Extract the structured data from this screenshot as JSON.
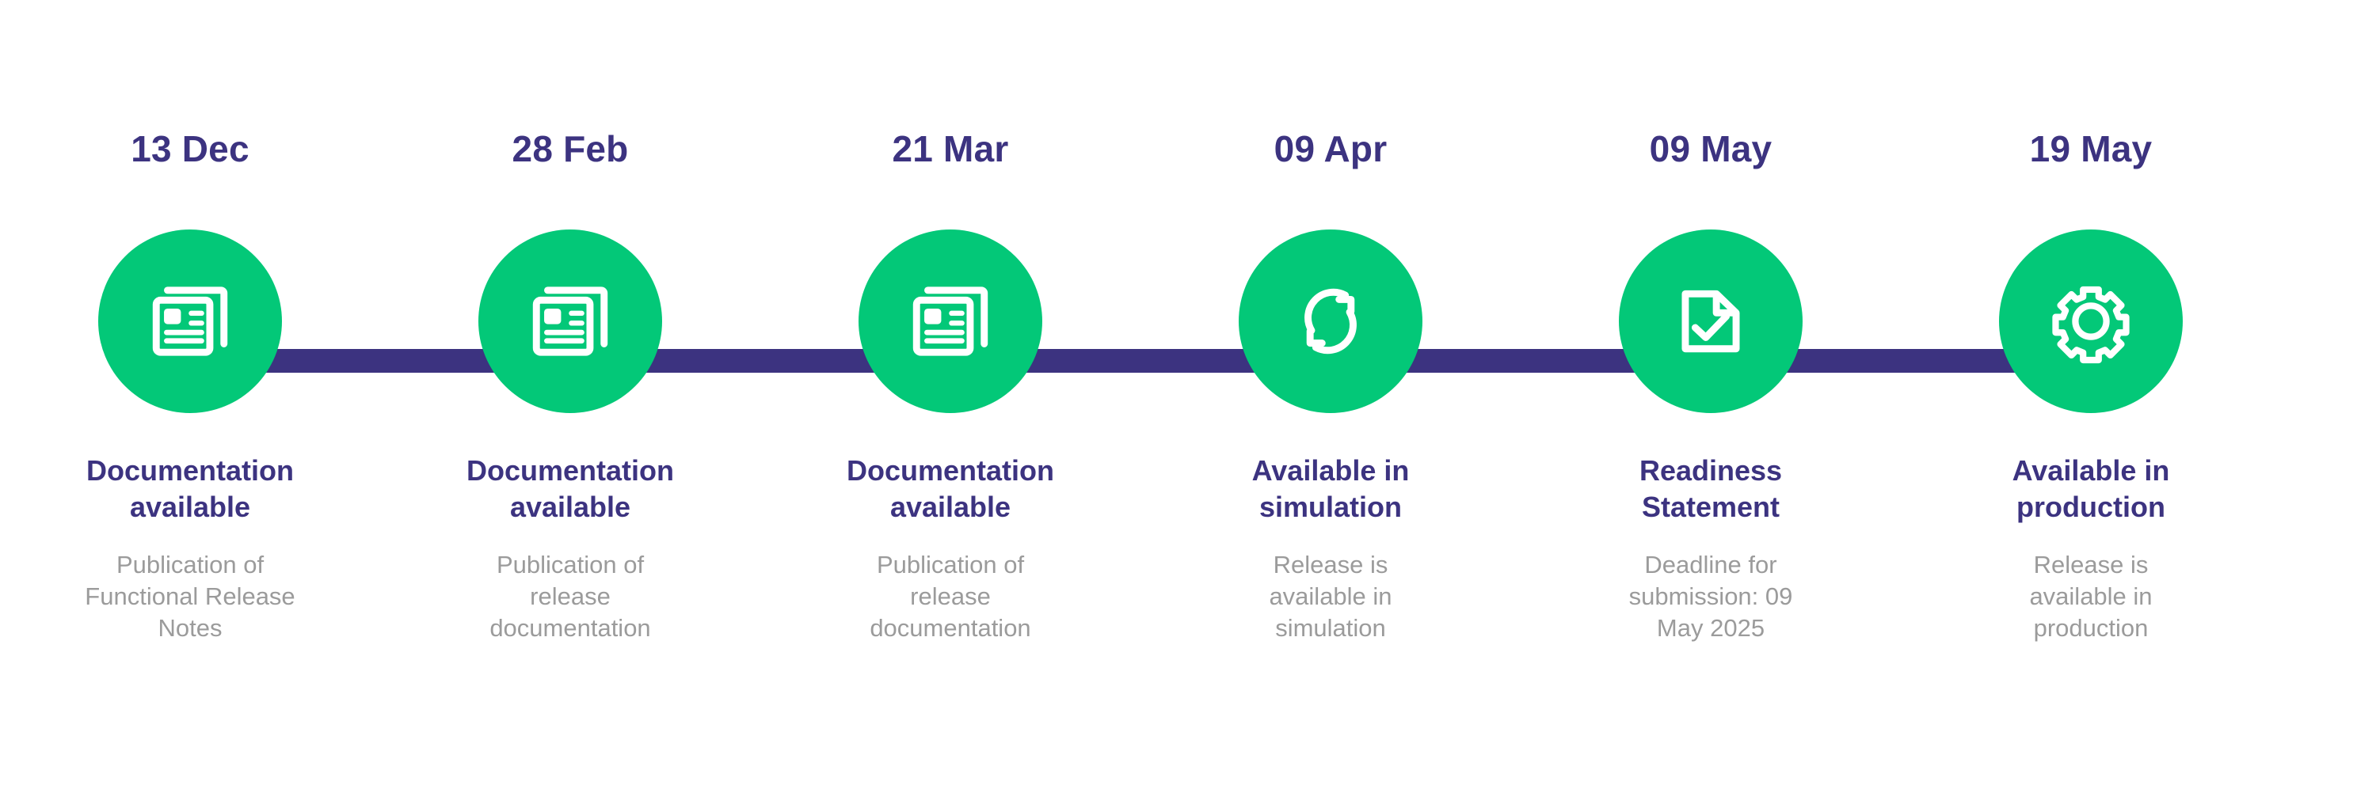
{
  "theme": {
    "accent_green": "#03C878",
    "accent_purple": "#3C3380",
    "description_gray": "#9B9B9B",
    "background": "#FFFFFF"
  },
  "timeline": {
    "name": "release-timeline",
    "orientation": "horizontal",
    "steps": [
      {
        "date": "13 Dec",
        "icon": "newspaper-icon",
        "title_line1": "Documentation",
        "title_line2": "available",
        "desc_line1": "Publication of",
        "desc_line2": "Functional Release",
        "desc_line3": "Notes"
      },
      {
        "date": "28 Feb",
        "icon": "newspaper-icon",
        "title_line1": "Documentation",
        "title_line2": "available",
        "desc_line1": "Publication of",
        "desc_line2": "release",
        "desc_line3": "documentation"
      },
      {
        "date": "21 Mar",
        "icon": "newspaper-icon",
        "title_line1": "Documentation",
        "title_line2": "available",
        "desc_line1": "Publication of",
        "desc_line2": "release",
        "desc_line3": "documentation"
      },
      {
        "date": "09 Apr",
        "icon": "sync-refresh-icon",
        "title_line1": "Available in",
        "title_line2": "simulation",
        "desc_line1": "Release is",
        "desc_line2": "available in",
        "desc_line3": "simulation"
      },
      {
        "date": "09 May",
        "icon": "document-check-icon",
        "title_line1": "Readiness",
        "title_line2": "Statement",
        "desc_line1": "Deadline for",
        "desc_line2": "submission: 09",
        "desc_line3": "May 2025"
      },
      {
        "date": "19 May",
        "icon": "gear-icon",
        "title_line1": "Available in",
        "title_line2": "production",
        "desc_line1": "Release is",
        "desc_line2": "available in",
        "desc_line3": "production"
      }
    ]
  }
}
